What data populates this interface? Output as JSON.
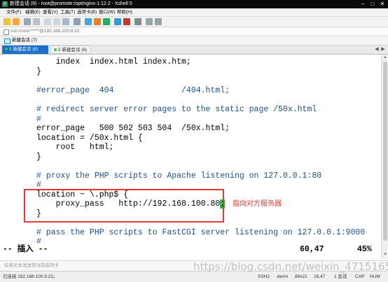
{
  "window": {
    "title": "新建会话 (8) - root@promote:/opt/nginx-1.12.2 - Xshell 5",
    "app_icon": "xshell-icon",
    "controls": [
      "minimize-icon",
      "maximize-icon",
      "close-icon"
    ]
  },
  "menubar": {
    "items": [
      "文件(F)",
      "编辑(E)",
      "查看(V)",
      "工具(T)",
      "选项卡(B)",
      "窗口(W)",
      "帮助(H)"
    ]
  },
  "address": {
    "text": "ssh://root:*****@192.168.100.8:22"
  },
  "session_bar": {
    "label": "新建会话 (7)"
  },
  "tabs": [
    {
      "label": "1 新建会话 (8)",
      "active": true,
      "dot_color": "#22c55e"
    },
    {
      "label": "2 新建会话 (6)",
      "active": false,
      "dot_color": "#22c55e"
    }
  ],
  "terminal": {
    "lines": [
      {
        "text": "    index  index.html index.htm;",
        "style": "def"
      },
      {
        "text": "}",
        "style": "def"
      },
      {
        "text": "",
        "style": "def"
      },
      {
        "text": "#error_page  404              /404.html;",
        "style": "cmt"
      },
      {
        "text": "",
        "style": "def"
      },
      {
        "text": "# redirect server error pages to the static page /50x.html",
        "style": "cmt"
      },
      {
        "text": "#",
        "style": "cmt"
      },
      {
        "text": "error_page   500 502 503 504  /50x.html;",
        "style": "def"
      },
      {
        "text": "location = /50x.html {",
        "style": "def"
      },
      {
        "text": "    root   html;",
        "style": "def"
      },
      {
        "text": "}",
        "style": "def"
      },
      {
        "text": "",
        "style": "def"
      },
      {
        "text": "# proxy the PHP scripts to Apache listening on 127.0.0.1:80",
        "style": "cmt"
      },
      {
        "text": "#",
        "style": "cmt"
      },
      {
        "text": "location ~ \\.php$ {",
        "style": "def"
      },
      {
        "text": "    proxy_pass   http://192.168.100.80",
        "style": "def",
        "cursor": ";"
      },
      {
        "text": "}",
        "style": "def"
      },
      {
        "text": "",
        "style": "def"
      },
      {
        "text": "# pass the PHP scripts to FastCGI server listening on 127.0.0.1:9000",
        "style": "cmt"
      },
      {
        "text": "#",
        "style": "cmt"
      }
    ],
    "mode": "-- 插入 --",
    "position": "60,47",
    "percent": "45%"
  },
  "annotation": {
    "text": "指向对方服务器",
    "color": "#e53935"
  },
  "send_bar": {
    "placeholder": "仅将文本发送到当前选项卡"
  },
  "statusbar": {
    "connection": "已连接 192.168.100.8:22。",
    "protocol": "SSH2",
    "terminal_type": "xterm",
    "size": "89x21",
    "cursor_pos": "16,47",
    "sessions": "1 会话",
    "caps": "CAP",
    "num": "NUM"
  },
  "watermark": "https://blog.csdn.net/weixin_47151650",
  "colors": {
    "titlebar": "#0a0a0a",
    "tab_active": "#1a6fc6",
    "comment": "#1f4f8a",
    "highlight": "#e53935",
    "cursor": "#22c55e"
  }
}
